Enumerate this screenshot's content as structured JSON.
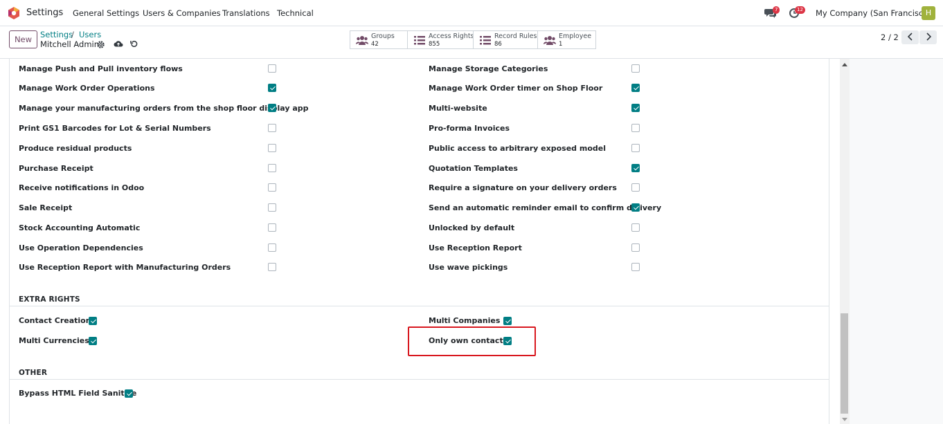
{
  "navbar": {
    "app_name": "Settings",
    "menu": [
      "General Settings",
      "Users & Companies",
      "Translations",
      "Technical"
    ],
    "messages_badge": "7",
    "activities_badge": "12",
    "company": "My Company (San Francisco)",
    "avatar_letter": "H"
  },
  "control_panel": {
    "new_label": "New",
    "breadcrumb": [
      "Settings",
      "Users"
    ],
    "breadcrumb_sep": "/",
    "record_name": "Mitchell Admin",
    "smart_buttons": [
      {
        "label": "Groups",
        "count": "42"
      },
      {
        "label": "Access Rights",
        "count": "855"
      },
      {
        "label": "Record Rules",
        "count": "86"
      },
      {
        "label": "Employee",
        "count": "1"
      }
    ],
    "pager": "2 / 2"
  },
  "rights_left": [
    {
      "label": "Manage Push and Pull inventory flows",
      "checked": false
    },
    {
      "label": "Manage Work Order Operations",
      "checked": true
    },
    {
      "label": "Manage your manufacturing orders from the shop floor display app",
      "checked": true
    },
    {
      "label": "Print GS1 Barcodes for Lot & Serial Numbers",
      "checked": false
    },
    {
      "label": "Produce residual products",
      "checked": false
    },
    {
      "label": "Purchase Receipt",
      "checked": false
    },
    {
      "label": "Receive notifications in Odoo",
      "checked": false
    },
    {
      "label": "Sale Receipt",
      "checked": false
    },
    {
      "label": "Stock Accounting Automatic",
      "checked": false
    },
    {
      "label": "Use Operation Dependencies",
      "checked": false
    },
    {
      "label": "Use Reception Report with Manufacturing Orders",
      "checked": false
    }
  ],
  "rights_right": [
    {
      "label": "Manage Storage Categories",
      "checked": false
    },
    {
      "label": "Manage Work Order timer on Shop Floor",
      "checked": true
    },
    {
      "label": "Multi-website",
      "checked": true
    },
    {
      "label": "Pro-forma Invoices",
      "checked": false
    },
    {
      "label": "Public access to arbitrary exposed model",
      "checked": false
    },
    {
      "label": "Quotation Templates",
      "checked": true
    },
    {
      "label": "Require a signature on your delivery orders",
      "checked": false
    },
    {
      "label": "Send an automatic reminder email to confirm delivery",
      "checked": true
    },
    {
      "label": "Unlocked by default",
      "checked": false
    },
    {
      "label": "Use Reception Report",
      "checked": false
    },
    {
      "label": "Use wave pickings",
      "checked": false
    }
  ],
  "extra_rights": {
    "title": "EXTRA RIGHTS",
    "left": [
      {
        "label": "Contact Creation",
        "checked": true
      },
      {
        "label": "Multi Currencies",
        "checked": true
      }
    ],
    "right": [
      {
        "label": "Multi Companies",
        "checked": true
      },
      {
        "label": "Only own contacts",
        "checked": true
      }
    ]
  },
  "other": {
    "title": "OTHER",
    "items": [
      {
        "label": "Bypass HTML Field Sanitize",
        "checked": true
      }
    ]
  },
  "colors": {
    "accent": "#017e84",
    "brand": "#714b67",
    "highlight": "#d8171e",
    "badge": "#dc3545"
  }
}
